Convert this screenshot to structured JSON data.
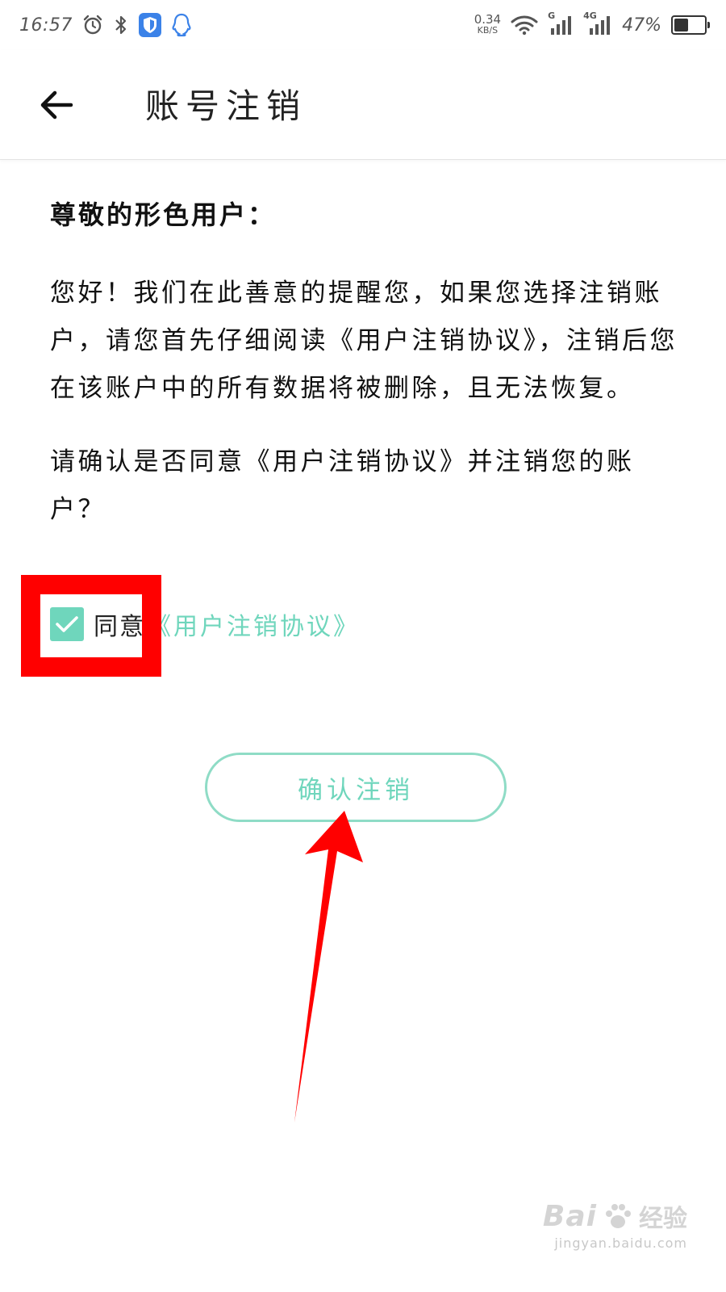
{
  "status_bar": {
    "time": "16:57",
    "net_speed_value": "0.34",
    "net_speed_unit": "KB/S",
    "sim1_tag": "G",
    "sim2_tag": "4G",
    "battery_percent": "47%",
    "battery_level": 0.47,
    "icons": [
      "alarm-icon",
      "bluetooth-icon",
      "shield-icon",
      "qq-icon",
      "wifi-icon",
      "signal-icon",
      "battery-icon"
    ]
  },
  "header": {
    "title": "账号注销"
  },
  "content": {
    "greeting": "尊敬的形色用户：",
    "paragraph1": "您好！我们在此善意的提醒您，如果您选择注销账户，请您首先仔细阅读《用户注销协议》，注销后您在该账户中的所有数据将被删除，且无法恢复。",
    "paragraph2": "请确认是否同意《用户注销协议》并注销您的账户？"
  },
  "agreement": {
    "checked": true,
    "label": "同意",
    "link_text": "《用户注销协议》"
  },
  "confirm_button": {
    "label": "确认注销"
  },
  "watermark": {
    "brand": "Bai",
    "brand_suffix": "经验",
    "url": "jingyan.baidu.com"
  },
  "colors": {
    "accent": "#6fd6bc",
    "button_border": "#8fdcc6",
    "annotation_red": "#ff0000"
  }
}
